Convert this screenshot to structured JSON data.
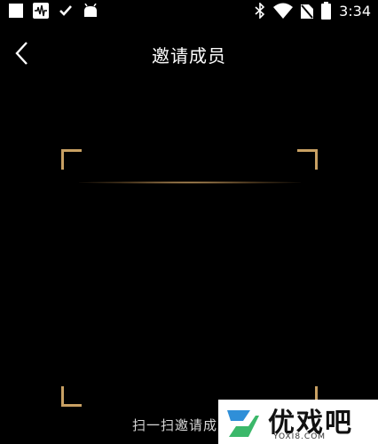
{
  "status_bar": {
    "time": "3:34",
    "left_icons": [
      "square-icon",
      "waveform-app-icon",
      "check-icon",
      "android-icon"
    ],
    "right_icons": [
      "bluetooth-icon",
      "wifi-icon",
      "no-sim-icon",
      "battery-icon"
    ]
  },
  "header": {
    "title": "邀请成员",
    "back_icon": "chevron-left-icon"
  },
  "scanner": {
    "hint": "扫一扫邀请成员的",
    "accent_color": "#c8a063"
  },
  "watermark": {
    "name": "优戏吧",
    "url": "YOXI8.COM"
  }
}
